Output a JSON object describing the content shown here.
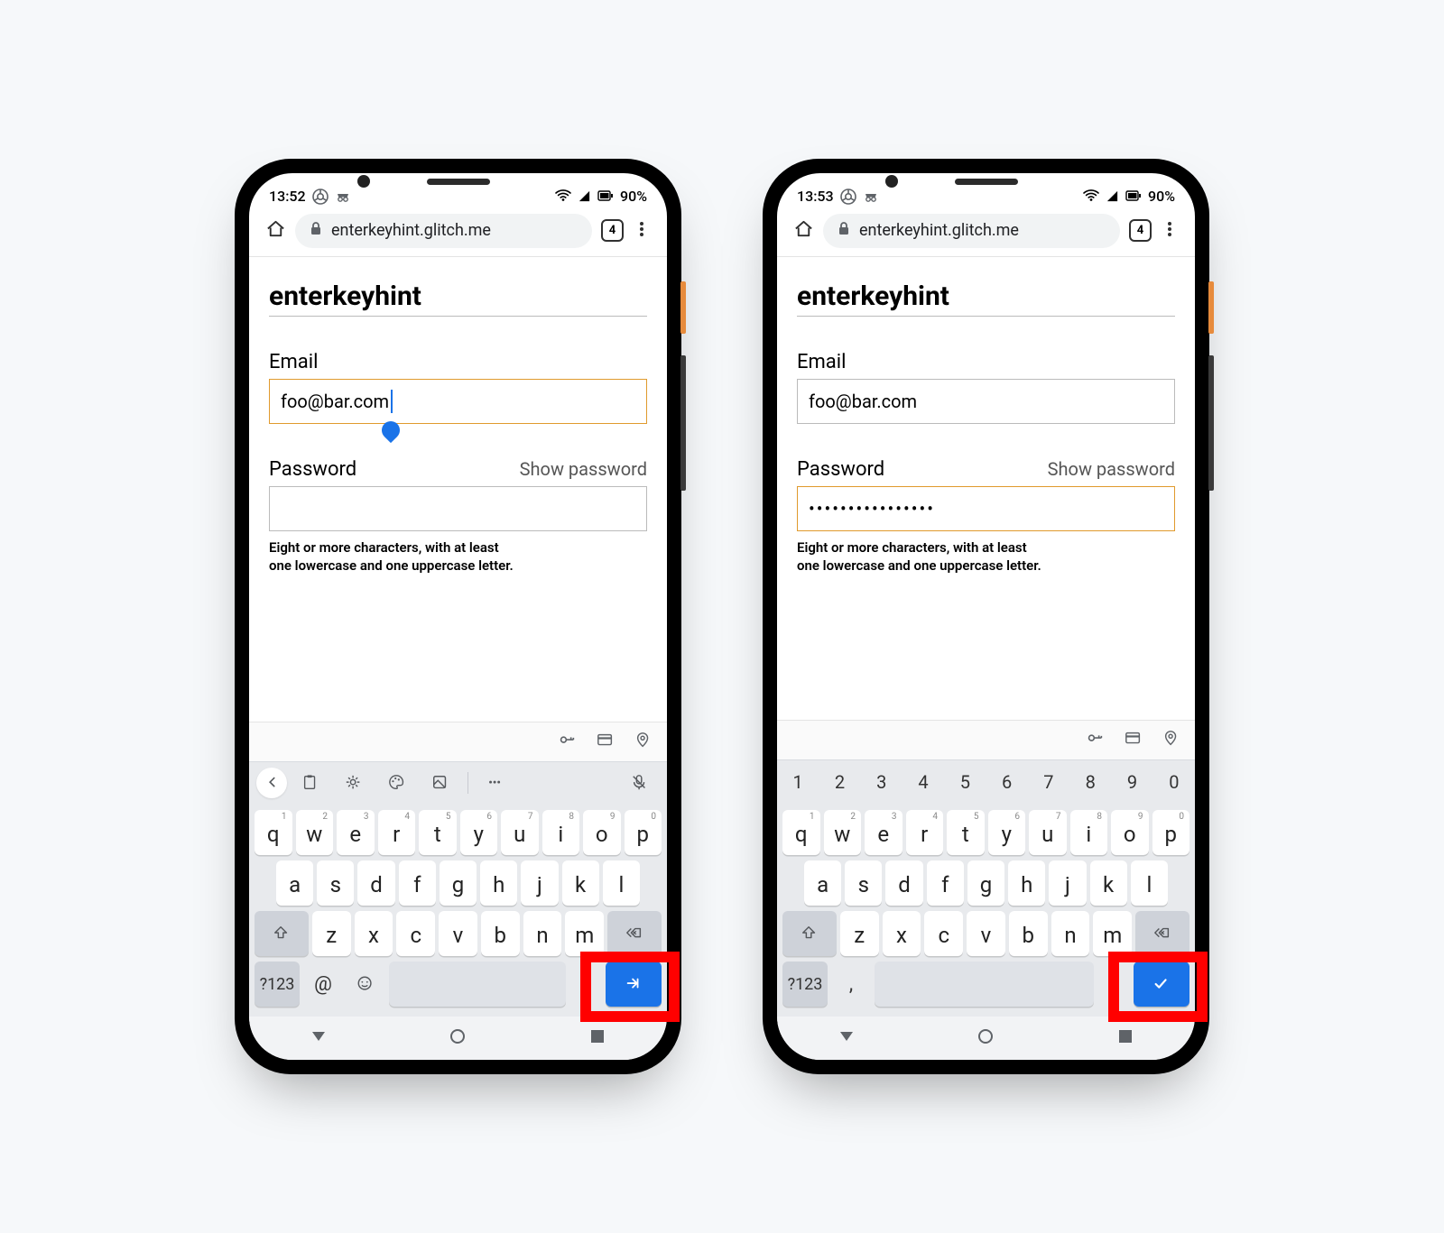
{
  "phones": [
    {
      "status": {
        "time": "13:52",
        "battery": "90%"
      },
      "chrome": {
        "url": "enterkeyhint.glitch.me",
        "tab_count": "4"
      },
      "page": {
        "title": "enterkeyhint",
        "email_label": "Email",
        "email_value": "foo@bar.com",
        "email_focused": true,
        "password_label": "Password",
        "show_password": "Show password",
        "password_value": "",
        "password_focused": false,
        "helper_line1": "Eight or more characters, with at least",
        "helper_line2": "one lowercase and one uppercase letter."
      },
      "keyboard": {
        "style": "suggestion",
        "enter_icon": "next",
        "bottom_extras": [
          "@",
          "emoji"
        ],
        "bottom_leading_char": "@"
      }
    },
    {
      "status": {
        "time": "13:53",
        "battery": "90%"
      },
      "chrome": {
        "url": "enterkeyhint.glitch.me",
        "tab_count": "4"
      },
      "page": {
        "title": "enterkeyhint",
        "email_label": "Email",
        "email_value": "foo@bar.com",
        "email_focused": false,
        "password_label": "Password",
        "show_password": "Show password",
        "password_value": "••••••••••••••••",
        "password_focused": true,
        "helper_line1": "Eight or more characters, with at least",
        "helper_line2": "one lowercase and one uppercase letter."
      },
      "keyboard": {
        "style": "numeric",
        "enter_icon": "done",
        "bottom_extras": [
          ","
        ],
        "bottom_leading_char": ","
      }
    }
  ],
  "keys": {
    "row1": [
      "q",
      "w",
      "e",
      "r",
      "t",
      "y",
      "u",
      "i",
      "o",
      "p"
    ],
    "sup1": [
      "1",
      "2",
      "3",
      "4",
      "5",
      "6",
      "7",
      "8",
      "9",
      "0"
    ],
    "row2": [
      "a",
      "s",
      "d",
      "f",
      "g",
      "h",
      "j",
      "k",
      "l"
    ],
    "row3": [
      "z",
      "x",
      "c",
      "v",
      "b",
      "n",
      "m"
    ],
    "symkey": "?123",
    "period": "."
  },
  "numrow": [
    "1",
    "2",
    "3",
    "4",
    "5",
    "6",
    "7",
    "8",
    "9",
    "0"
  ]
}
